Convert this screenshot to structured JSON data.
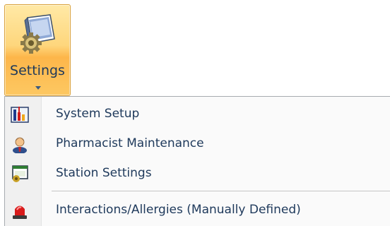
{
  "ribbon": {
    "settings_label": "Settings",
    "settings_icon": "settings-book-gear-icon",
    "dropdown_icon": "chevron-down-icon"
  },
  "menu": {
    "items": [
      {
        "label": "System Setup",
        "icon": "system-setup-icon"
      },
      {
        "label": "Pharmacist Maintenance",
        "icon": "pharmacist-user-icon"
      },
      {
        "label": "Station Settings",
        "icon": "station-window-icon"
      },
      {
        "label": "Interactions/Allergies (Manually Defined)",
        "icon": "red-alarm-light-icon"
      }
    ]
  },
  "colors": {
    "text": "#1e395b",
    "button_hot_top": "#ffe9a6",
    "button_hot_bottom": "#fdb64a",
    "menu_background": "#fafafa",
    "menu_border": "#a7abb0"
  }
}
